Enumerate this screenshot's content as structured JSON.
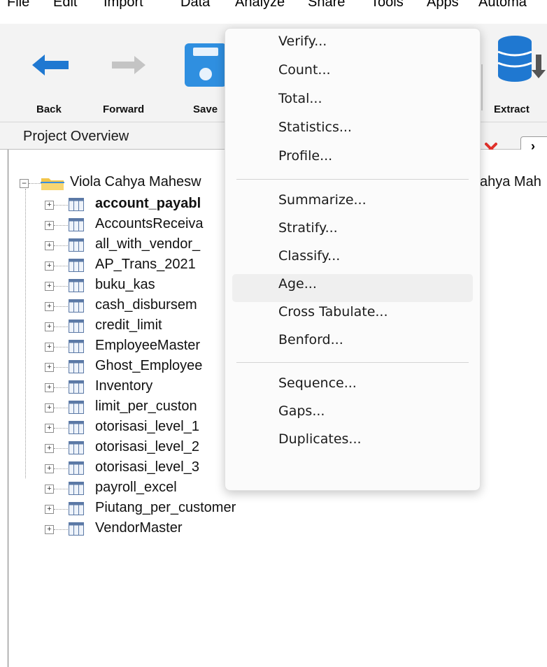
{
  "menubar": {
    "items": [
      "File",
      "Edit",
      "Import",
      "Data",
      "Analyze",
      "Share",
      "Tools",
      "Apps",
      "Automa"
    ]
  },
  "toolbar": {
    "back_label": "Back",
    "forward_label": "Forward",
    "save_label": "Save",
    "extract_label": "Extract"
  },
  "panel": {
    "title": "Project Overview"
  },
  "tree": {
    "root_label": "Viola Cahya Mahesw",
    "root_label_tail": "ahya Mah",
    "items": [
      {
        "label": "account_payabl",
        "bold": true
      },
      {
        "label": "AccountsReceiva"
      },
      {
        "label": "all_with_vendor_"
      },
      {
        "label": "AP_Trans_2021"
      },
      {
        "label": "buku_kas"
      },
      {
        "label": "cash_disbursem"
      },
      {
        "label": "credit_limit"
      },
      {
        "label": "EmployeeMaster"
      },
      {
        "label": "Ghost_Employee"
      },
      {
        "label": "Inventory"
      },
      {
        "label": "limit_per_custon"
      },
      {
        "label": "otorisasi_level_1"
      },
      {
        "label": "otorisasi_level_2"
      },
      {
        "label": "otorisasi_level_3"
      },
      {
        "label": "payroll_excel"
      },
      {
        "label": "Piutang_per_customer"
      },
      {
        "label": "VendorMaster"
      }
    ]
  },
  "analyze_menu": {
    "groups": [
      [
        "Verify...",
        "Count...",
        "Total...",
        "Statistics...",
        "Profile..."
      ],
      [
        "Summarize...",
        "Stratify...",
        "Classify...",
        "Age...",
        "Cross Tabulate...",
        "Benford..."
      ],
      [
        "Sequence...",
        "Gaps...",
        "Duplicates..."
      ]
    ],
    "hovered": "Age..."
  },
  "colors": {
    "back_arrow": "#1f78d1",
    "forward_arrow": "#c4c4c4",
    "save_icon": "#2f8fe0",
    "close_x": "#e0302a",
    "folder": "#f2c54a",
    "table_icon": "#5b79a6"
  }
}
